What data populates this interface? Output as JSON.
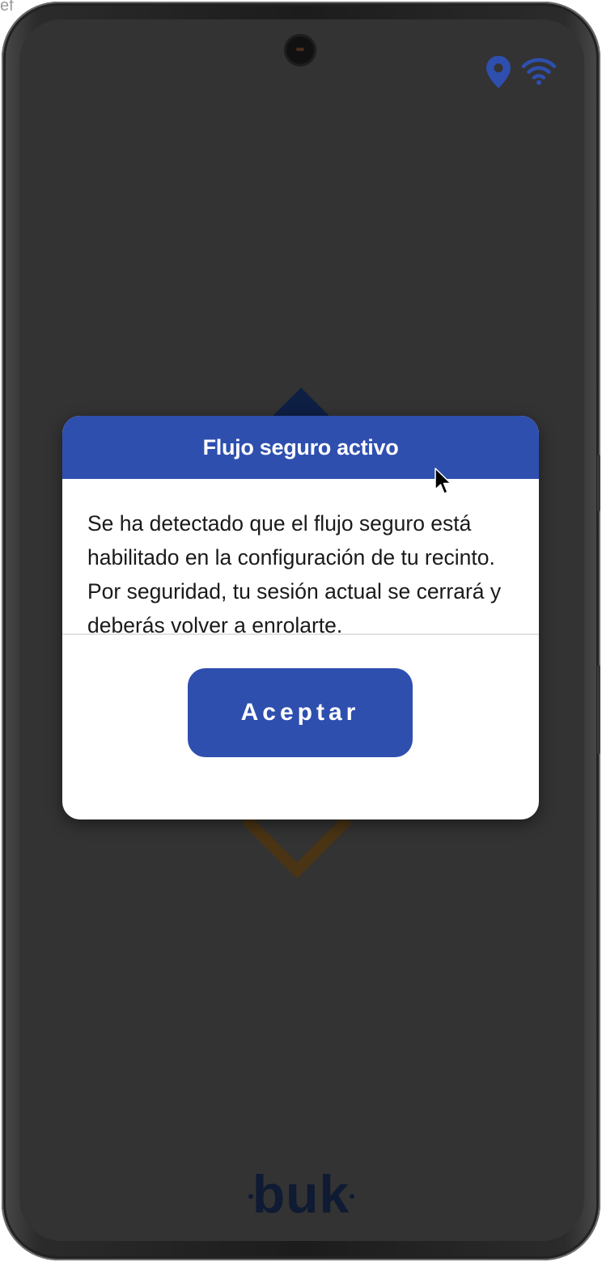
{
  "corner_text": "ef",
  "status_bar": {
    "icons": [
      "location-pin-icon",
      "wifi-icon"
    ],
    "icon_color": "#2f4faf"
  },
  "dialog": {
    "title": "Flujo seguro activo",
    "message": "Se ha detectado que el flujo seguro está habilitado en la configuración de tu recinto. Por seguridad, tu sesión actual se cerrará y deberás volver a enrolarte.",
    "accept_label": "Aceptar",
    "accent_color": "#2f4faf"
  },
  "brand": {
    "logo_text": "buk"
  },
  "colors": {
    "screen_background": "#333333",
    "dialog_background": "#ffffff",
    "body_text": "#1a1a1a"
  }
}
